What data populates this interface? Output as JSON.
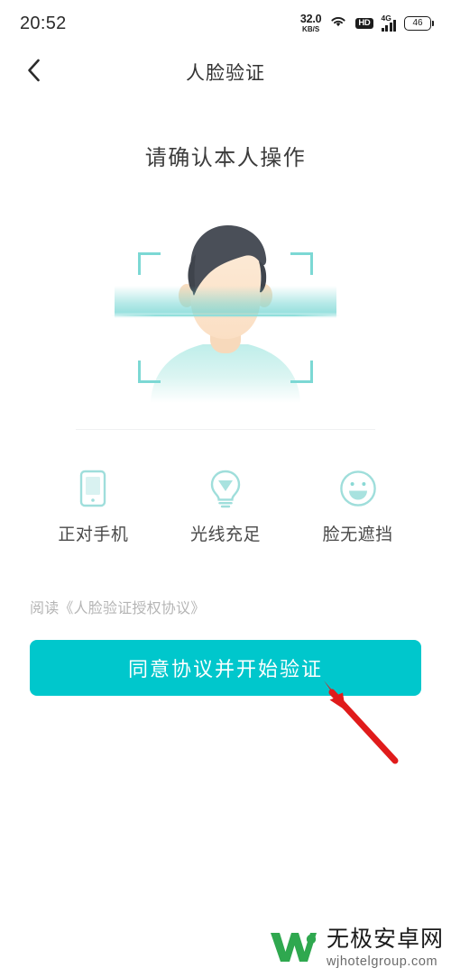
{
  "status_bar": {
    "time": "20:52",
    "net_speed_value": "32.0",
    "net_speed_unit": "KB/S",
    "wifi_icon": "wifi-icon",
    "hd_label": "HD",
    "network_type": "4G",
    "signal_icon": "signal-bars-icon",
    "battery_level": "46"
  },
  "nav": {
    "back_icon": "chevron-left-icon",
    "title": "人脸验证"
  },
  "main": {
    "headline": "请确认本人操作",
    "avatar_icon": "face-avatar-illustration",
    "scan_frame_icon": "face-scan-frame-icon",
    "tips": [
      {
        "icon": "phone-icon",
        "label": "正对手机"
      },
      {
        "icon": "lightbulb-icon",
        "label": "光线充足"
      },
      {
        "icon": "smiley-face-icon",
        "label": "脸无遮挡"
      }
    ],
    "agreement_prefix": "阅读",
    "agreement_link": "《人脸验证授权协议》",
    "agreement_full": "阅读《人脸验证授权协议》",
    "primary_button": "同意协议并开始验证",
    "annotation_icon": "red-arrow-pointing-to-button"
  },
  "watermark": {
    "logo_icon": "w-logo-icon",
    "name_cn": "无极安卓网",
    "name_en": "wjhotelgroup.com"
  },
  "colors": {
    "accent": "#00c7cc",
    "scan_frame": "#7cd8d4",
    "tip_icon": "#9fdedb",
    "hair": "#4a4f58",
    "skin": "#fbe3cd",
    "shirt": "#c8efec",
    "annotation_red": "#e01b1b",
    "logo_green": "#2fa84f",
    "title_text": "#333333",
    "muted_text": "#b5b5b5"
  }
}
